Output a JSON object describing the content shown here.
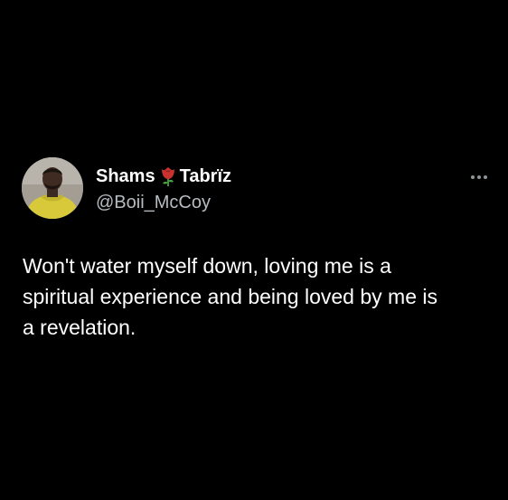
{
  "tweet": {
    "author": {
      "name_first": "Shams",
      "name_emoji": "rose-emoji",
      "name_last": "Tabrïz",
      "handle": "@Boii_McCoy",
      "avatar": "profile-photo"
    },
    "more_icon": "more-horizontal-icon",
    "text": "Won't water myself down, loving me is a\nspiritual experience and being loved by me is\na revelation."
  },
  "colors": {
    "background": "#000000",
    "name": "#ffffff",
    "handle": "#b7bcc1",
    "body": "#ffffff",
    "rose": "#c8322f"
  }
}
